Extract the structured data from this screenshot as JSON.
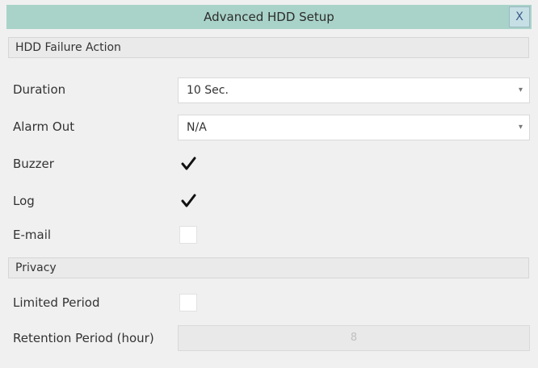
{
  "dialog": {
    "title": "Advanced HDD Setup",
    "close_label": "X"
  },
  "hdd_failure": {
    "section_title": "HDD Failure Action",
    "duration_label": "Duration",
    "duration_value": "10 Sec.",
    "alarm_out_label": "Alarm Out",
    "alarm_out_value": "N/A",
    "buzzer_label": "Buzzer",
    "buzzer_checked": true,
    "log_label": "Log",
    "log_checked": true,
    "email_label": "E-mail",
    "email_checked": false
  },
  "privacy": {
    "section_title": "Privacy",
    "limited_period_label": "Limited Period",
    "limited_period_checked": false,
    "retention_label": "Retention Period (hour)",
    "retention_value": "8"
  },
  "icons": {
    "dropdown": "chevron-down-icon",
    "check": "checkmark-icon",
    "close": "close-icon"
  }
}
